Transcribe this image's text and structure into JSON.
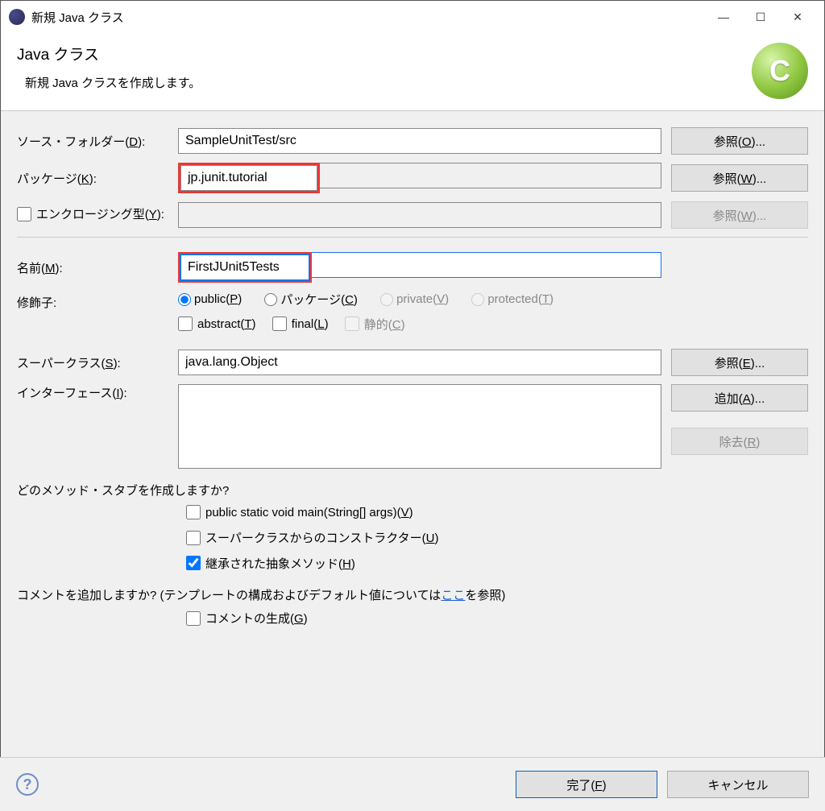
{
  "title": "新規 Java クラス",
  "header": {
    "h1": "Java クラス",
    "p": "新規 Java クラスを作成します。"
  },
  "labels": {
    "sourceFolder": "ソース・フォルダー(",
    "sourceFolderU": "D",
    "sourceFolderAfter": "):",
    "package": "パッケージ(",
    "packageU": "K",
    "packageAfter": "):",
    "enclosing": "エンクロージング型(",
    "enclosingU": "Y",
    "enclosingAfter": "):",
    "name": "名前(",
    "nameU": "M",
    "nameAfter": "):",
    "modifiers": "修飾子:",
    "superclass": "スーパークラス(",
    "superclassU": "S",
    "superclassAfter": "):",
    "interfaces": "インターフェース(",
    "interfacesU": "I",
    "interfacesAfter": "):",
    "stubQ": "どのメソッド・スタブを作成しますか?",
    "commentQpre": "コメントを追加しますか? (テンプレートの構成およびデフォルト値については",
    "commentQlink": "ここ",
    "commentQpost": "を参照)"
  },
  "fields": {
    "sourceFolder": "SampleUnitTest/src",
    "package": "jp.junit.tutorial",
    "enclosing": "",
    "name": "FirstJUnit5Tests",
    "superclass": "java.lang.Object"
  },
  "buttons": {
    "browseO": "参照(O)...",
    "browseW": "参照(W)...",
    "browseW2": "参照(W)...",
    "browseE": "参照(E)...",
    "addA": "追加(A)...",
    "removeR": "除去(R)",
    "finish": "完了(F)",
    "cancel": "キャンセル"
  },
  "mods": {
    "public": "public(P)",
    "package": "パッケージ(C)",
    "private": "private(V)",
    "protected": "protected(T)",
    "abstract": "abstract(T)",
    "final": "final(L)",
    "static": "静的(C)"
  },
  "stubs": {
    "main": "public static void main(String[] args)(V)",
    "superCtor": "スーパークラスからのコンストラクター(U)",
    "inherited": "継承された抽象メソッド(H)"
  },
  "comments": {
    "gen": "コメントの生成(G)"
  }
}
